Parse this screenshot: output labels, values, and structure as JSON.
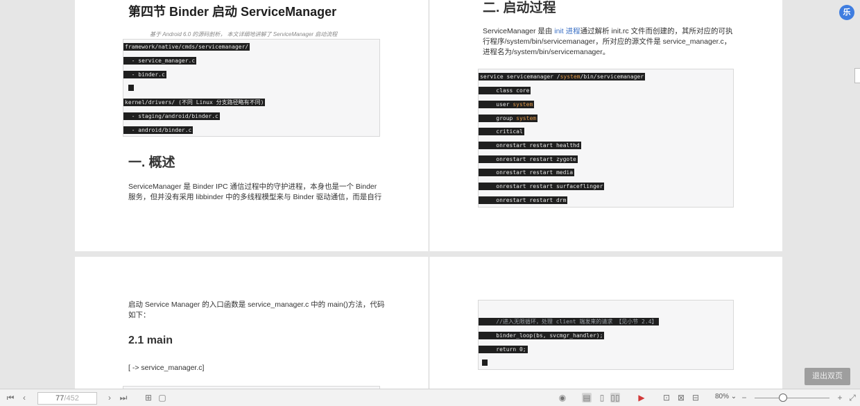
{
  "document": {
    "left_page_top": {
      "title": "第四节 Binder 启动 ServiceManager",
      "caption": "基于 Android 6.0 的源码剖析， 本文详细地讲解了 ServiceManager 启动流程",
      "code_lines": [
        "framework/native/cmds/servicemanager/",
        "  - service_manager.c",
        "  - binder.c",
        "",
        "kernel/drivers/ (不同 Linux 分支路径略有不同)",
        "  - staging/android/binder.c",
        "  - android/binder.c"
      ],
      "section1_title": "一. 概述",
      "section1_text_line1": "ServiceManager 是 Binder IPC 通信过程中的守护进程，本身也是一个 Binder",
      "section1_text_line2": "服务，但并没有采用 libbinder 中的多线程模型来与 Binder 驱动通信，而是自行"
    },
    "right_page_top": {
      "section2_title": "二. 启动过程",
      "intro_part1": "ServiceManager 是由 ",
      "intro_link": "init 进程",
      "intro_part2": "通过解析 init.rc 文件而创建的，其所对应的可执",
      "intro_line2": "行程序/system/bin/servicemanager，所对应的源文件是 service_manager.c，",
      "intro_line3": "进程名为/system/bin/servicemanager。",
      "code": {
        "l1_a": "service servicemanager /",
        "l1_kw": "system",
        "l1_b": "/bin/servicemanager",
        "l2": "    class core",
        "l3_a": "    user ",
        "l3_kw": "system",
        "l4_a": "    group ",
        "l4_kw": "system",
        "l5": "    critical",
        "l6": "    onrestart restart healthd",
        "l7": "    onrestart restart zygote",
        "l8": "    onrestart restart media",
        "l9": "    onrestart restart surfaceflinger",
        "l10": "    onrestart restart drm"
      }
    },
    "left_page_bottom": {
      "intro_line1": "启动 Service Manager 的入口函数是 service_manager.c 中的 main()方法，代码",
      "intro_line2": "如下：",
      "subsection_title": "2.1 main",
      "source_ref": "[ -> service_manager.c]"
    },
    "right_page_bottom": {
      "code_comment": "    //进入无限循环，处理 client 端发来的请求 【见小节 2.4】",
      "code_l2": "    binder_loop(bs, svcmgr_handler);",
      "code_l3": "    return 0;"
    }
  },
  "toolbar": {
    "page_current": "77",
    "page_total": "/452",
    "zoom": "80%",
    "zoom_level_percent": 80,
    "exit_button_label": "退出双页",
    "fab_label": "乐"
  }
}
